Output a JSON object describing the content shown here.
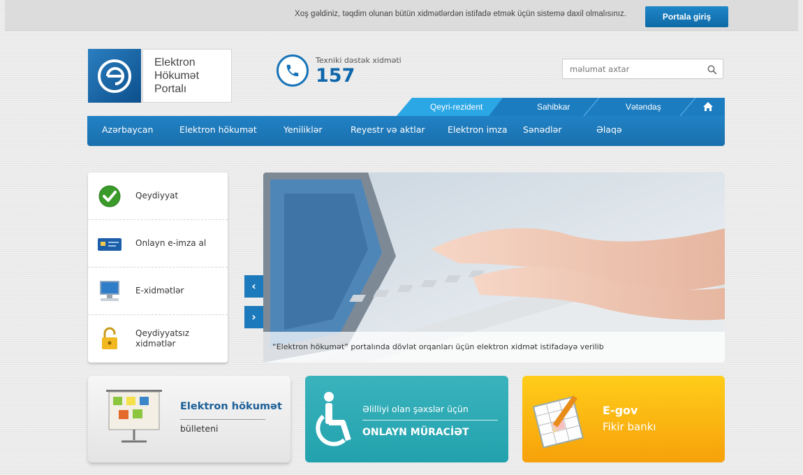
{
  "topbar": {
    "welcome": "Xoş gəldiniz, təqdim olunan bütün xidmətlərdən istifadə etmək üçün sistemə daxil olmalısınız.",
    "login_button": "Portala giriş"
  },
  "logo": {
    "line1": "Elektron",
    "line2": "Hökumət",
    "line3": "Portalı"
  },
  "support": {
    "label": "Texniki dəstək xidməti",
    "number": "157"
  },
  "search": {
    "placeholder": "məlumat axtar"
  },
  "audience_tabs": [
    "Qeyri-rezident",
    "Sahibkar",
    "Vətəndaş"
  ],
  "main_nav": [
    "Azərbaycan",
    "Elektron hökumət",
    "Yeniliklər",
    "Reyestr və aktlar",
    "Elektron imza",
    "Sənədlər",
    "Əlaqə"
  ],
  "side_menu": [
    {
      "label": "Qeydiyyat",
      "icon": "checkmark-icon"
    },
    {
      "label": "Onlayn e-imza al",
      "icon": "id-card-icon"
    },
    {
      "label": "E-xidmətlər",
      "icon": "computer-icon"
    },
    {
      "label_line1": "Qeydiyyatsız",
      "label_line2": "xidmətlər",
      "icon": "unlock-icon"
    }
  ],
  "slider": {
    "caption": "“Elektron hökumət” portalında dövlət orqanları üçün elektron xidmət istifadəyə verilib"
  },
  "tiles": {
    "bulletin": {
      "title": "Elektron hökumət",
      "subtitle": "bülleteni"
    },
    "disability": {
      "title": "Əlilliyi olan şəxslər üçün",
      "subtitle": "ONLAYN MÜRACİƏT"
    },
    "egov": {
      "title": "E-gov",
      "subtitle": "Fikir bankı"
    }
  },
  "colors": {
    "primary_blue": "#1a72b5",
    "accent_blue": "#2ca7e6",
    "teal": "#2aaab4",
    "orange": "#f9b312"
  }
}
